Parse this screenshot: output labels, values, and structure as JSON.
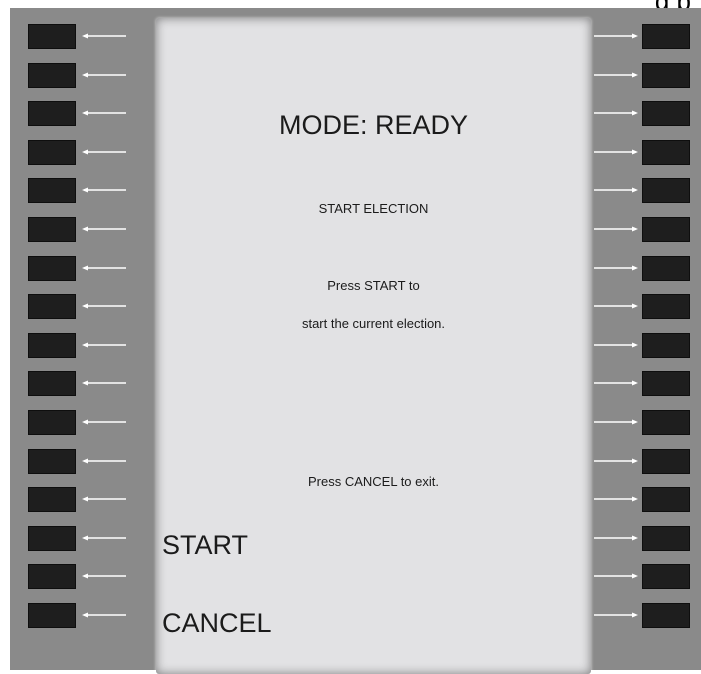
{
  "header": {
    "clipped_text": "g p"
  },
  "screen": {
    "mode_label": "MODE: READY",
    "heading": "START ELECTION",
    "instruction_line1": "Press START to",
    "instruction_line2": "start the current election.",
    "cancel_hint": "Press CANCEL to exit."
  },
  "softkeys": {
    "start_label": "START",
    "cancel_label": "CANCEL"
  }
}
